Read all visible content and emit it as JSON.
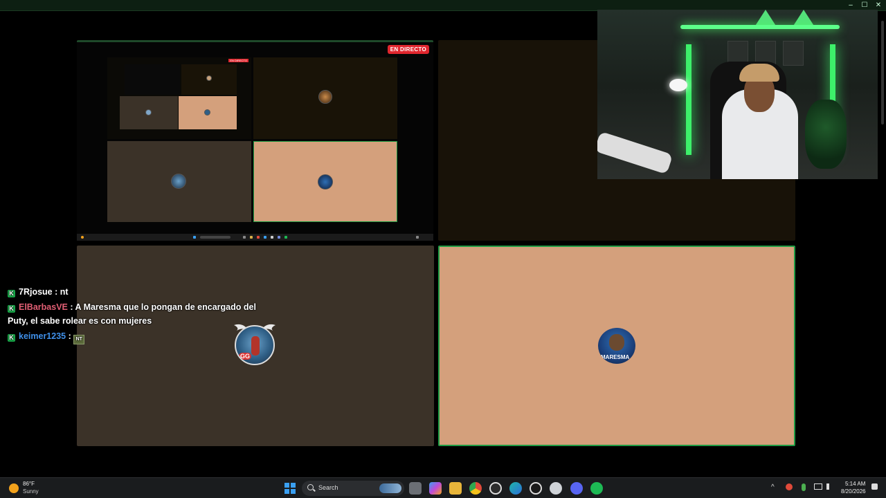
{
  "window": {
    "minimize": "–",
    "maximize": "☐",
    "close": "✕"
  },
  "stream": {
    "live_badge": "EN DIRECTO",
    "mini_live_badge": "EN DIRECTO"
  },
  "avatars": {
    "left_badge": "GG",
    "right_text": "MARESMA"
  },
  "chat": [
    {
      "badge": "K",
      "user": "7Rjosue",
      "sep": " : ",
      "message": "nt"
    },
    {
      "badge": "K",
      "user": "ElBarbasVE",
      "sep": " : ",
      "message": "A Maresma que lo pongan de encargado del Puty, el sabe rolear es con mujeres"
    },
    {
      "badge": "K",
      "user": "keimer1235",
      "sep": " : ",
      "emote": "NT"
    }
  ],
  "taskbar": {
    "weather_temp": "86°F",
    "weather_condition": "Sunny",
    "search_label": "Search",
    "apps": [
      "file-explorer-icon",
      "copilot-icon",
      "folder-icon",
      "chrome-icon",
      "obs-icon",
      "edge-icon",
      "chatgpt-icon",
      "steam-icon",
      "discord-icon",
      "spotify-icon"
    ],
    "time": "5:14 AM",
    "date": "8/20/2026"
  },
  "colors": {
    "accent_green": "#1f9c44",
    "live_red": "#e0262e",
    "peach_tile": "#d4a07c",
    "brown_tile": "#3b3228",
    "user_pink": "#e25f74",
    "user_blue": "#3f8fe8"
  }
}
